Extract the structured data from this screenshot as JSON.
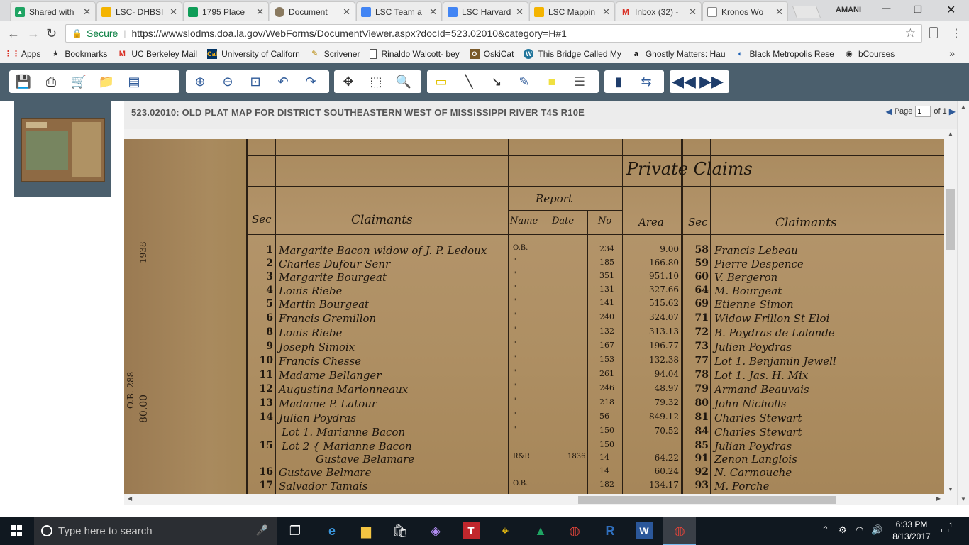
{
  "browser": {
    "tabs": [
      {
        "title": "Shared with",
        "icon": "google-drive-icon",
        "color": "#1fa463"
      },
      {
        "title": "LSC- DHBSI",
        "icon": "google-slides-icon",
        "color": "#f4b400"
      },
      {
        "title": "1795 Place",
        "icon": "google-sheets-icon",
        "color": "#0f9d58"
      },
      {
        "title": "Document",
        "icon": "seal-icon",
        "color": "#8a7a60"
      },
      {
        "title": "LSC Team a",
        "icon": "google-docs-icon",
        "color": "#4285f4"
      },
      {
        "title": "LSC Harvard",
        "icon": "google-docs-icon",
        "color": "#4285f4"
      },
      {
        "title": "LSC Mappin",
        "icon": "google-slides-icon",
        "color": "#f4b400"
      },
      {
        "title": "Inbox (32) -",
        "icon": "gmail-icon",
        "color": "#d93025"
      },
      {
        "title": "Kronos Wo",
        "icon": "page-icon",
        "color": "#888888"
      }
    ],
    "profile": "AMANI",
    "secure_label": "Secure",
    "url": "https://wwwslodms.doa.la.gov/WebForms/DocumentViewer.aspx?docId=523.02010&category=H#1",
    "bookmarks": [
      {
        "label": "Apps",
        "icon": "apps-grid-icon"
      },
      {
        "label": "Bookmarks",
        "icon": "star-icon"
      },
      {
        "label": "UC Berkeley Mail",
        "icon": "gmail-icon"
      },
      {
        "label": "University of Californ",
        "icon": "cal-icon"
      },
      {
        "label": "Scrivener",
        "icon": "scrivener-icon"
      },
      {
        "label": "Rinaldo Walcott- bey",
        "icon": "page-icon"
      },
      {
        "label": "OskiCat",
        "icon": "oskicat-icon"
      },
      {
        "label": "This Bridge Called My",
        "icon": "wordpress-icon"
      },
      {
        "label": "Ghostly Matters: Hau",
        "icon": "amazon-icon"
      },
      {
        "label": "Black Metropolis Rese",
        "icon": "globe-icon"
      },
      {
        "label": "bCourses",
        "icon": "bcourses-icon"
      }
    ]
  },
  "viewer": {
    "doc_title": "523.02010: OLD PLAT MAP FOR DISTRICT SOUTHEASTERN WEST OF MISSISSIPPI RIVER T4S R10E",
    "page_label": "Page",
    "page_current": "1",
    "page_of": "of",
    "page_total": "1"
  },
  "map": {
    "title": "Private Claims",
    "headers": {
      "sec": "Sec",
      "claimants": "Claimants",
      "report": "Report",
      "name": "Name",
      "date": "Date",
      "no": "No",
      "area": "Area",
      "sec2": "Sec",
      "claimants2": "Claimants"
    },
    "margin_text": [
      "1938",
      "80.00",
      "O.B. 288"
    ],
    "rows": [
      {
        "sec": "1",
        "claimant": "Margarite Bacon widow of J. P. Ledoux",
        "name": "O.B.",
        "date": "",
        "no": "234",
        "area": "9.00",
        "sec2": "58",
        "claimant2": "Francis Lebeau"
      },
      {
        "sec": "2",
        "claimant": "Charles Dufour Senr",
        "name": "\"",
        "date": "",
        "no": "185",
        "area": "166.80",
        "sec2": "59",
        "claimant2": "Pierre Despence"
      },
      {
        "sec": "3",
        "claimant": "Margarite Bourgeat",
        "name": "\"",
        "date": "",
        "no": "351",
        "area": "951.10",
        "sec2": "60",
        "claimant2": "V. Bergeron"
      },
      {
        "sec": "4",
        "claimant": "Louis Riebe",
        "name": "\"",
        "date": "",
        "no": "131",
        "area": "327.66",
        "sec2": "64",
        "claimant2": "M. Bourgeat"
      },
      {
        "sec": "5",
        "claimant": "Martin Bourgeat",
        "name": "\"",
        "date": "",
        "no": "141",
        "area": "515.62",
        "sec2": "69",
        "claimant2": "Etienne Simon"
      },
      {
        "sec": "6",
        "claimant": "Francis Gremillon",
        "name": "\"",
        "date": "",
        "no": "240",
        "area": "324.07",
        "sec2": "71",
        "claimant2": "Widow Frillon St Eloi"
      },
      {
        "sec": "8",
        "claimant": "Louis Riebe",
        "name": "\"",
        "date": "",
        "no": "132",
        "area": "313.13",
        "sec2": "72",
        "claimant2": "B. Poydras de Lalande"
      },
      {
        "sec": "9",
        "claimant": "Joseph Simoix",
        "name": "\"",
        "date": "",
        "no": "167",
        "area": "196.77",
        "sec2": "73",
        "claimant2": "Julien Poydras"
      },
      {
        "sec": "10",
        "claimant": "Francis Chesse",
        "name": "\"",
        "date": "",
        "no": "153",
        "area": "132.38",
        "sec2": "77",
        "claimant2": "Lot 1. Benjamin Jewell"
      },
      {
        "sec": "11",
        "claimant": "Madame Bellanger",
        "name": "\"",
        "date": "",
        "no": "261",
        "area": "94.04",
        "sec2": "78",
        "claimant2": "Lot 1. Jas. H. Mix"
      },
      {
        "sec": "12",
        "claimant": "Augustina Marionneaux",
        "name": "\"",
        "date": "",
        "no": "246",
        "area": "48.97",
        "sec2": "79",
        "claimant2": "Armand Beauvais"
      },
      {
        "sec": "13",
        "claimant": "Madame P. Latour",
        "name": "\"",
        "date": "",
        "no": "218",
        "area": "79.32",
        "sec2": "80",
        "claimant2": "John Nicholls"
      },
      {
        "sec": "14",
        "claimant": "Julian Poydras",
        "name": "\"",
        "date": "",
        "no": "56",
        "area": "849.12",
        "sec2": "81",
        "claimant2": "Charles Stewart"
      },
      {
        "sec": "",
        "claimant": "Lot 1. Marianne Bacon",
        "name": "\"",
        "date": "",
        "no": "150",
        "area": "70.52",
        "sec2": "84",
        "claimant2": "Charles Stewart"
      },
      {
        "sec": "15",
        "claimant": "Lot 2 { Marianne Bacon",
        "name": "",
        "date": "",
        "no": "150",
        "area": "",
        "sec2": "85",
        "claimant2": "Julian Poydras"
      },
      {
        "sec": "",
        "claimant": "Gustave Belamare",
        "name": "R&R",
        "date": "1836",
        "no": "14",
        "area": "64.22",
        "sec2": "91",
        "claimant2": "Zenon Langlois"
      },
      {
        "sec": "16",
        "claimant": "Gustave Belmare",
        "name": "",
        "date": "",
        "no": "14",
        "area": "60.24",
        "sec2": "92",
        "claimant2": "N. Carmouche"
      },
      {
        "sec": "17",
        "claimant": "Salvador Tamais",
        "name": "O.B.",
        "date": "",
        "no": "182",
        "area": "134.17",
        "sec2": "93",
        "claimant2": "M. Porche"
      }
    ]
  },
  "taskbar": {
    "search_placeholder": "Type here to search",
    "time": "6:33 PM",
    "date": "8/13/2017",
    "notification_count": "1"
  }
}
